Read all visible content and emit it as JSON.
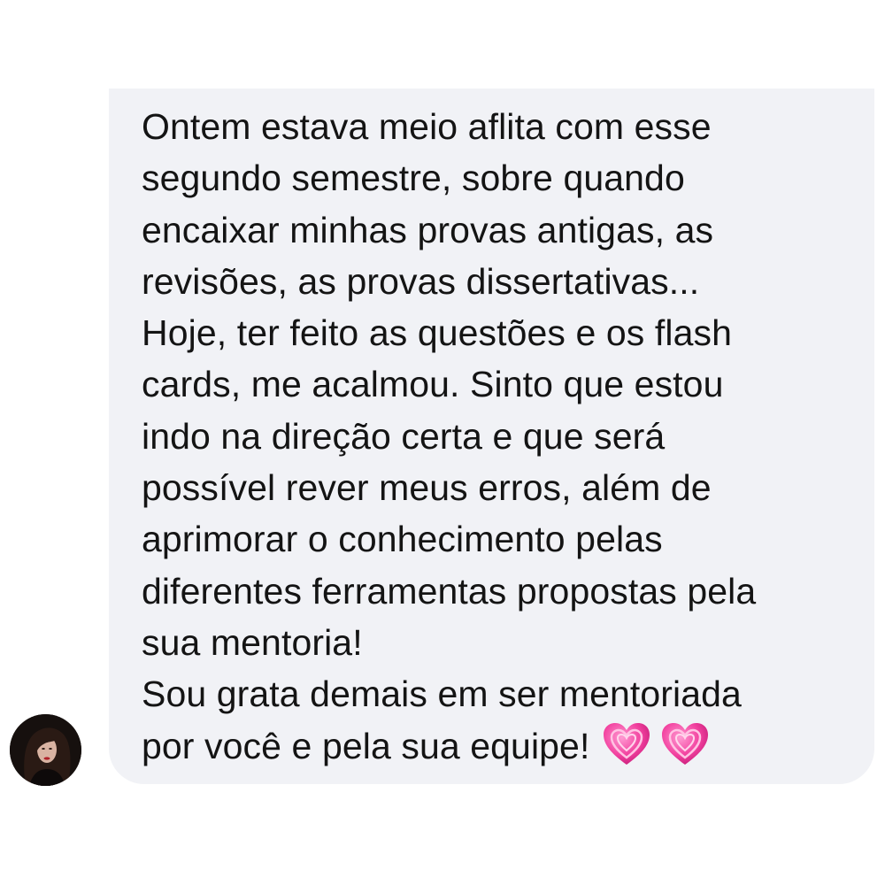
{
  "message": {
    "lines": [
      "Ontem estava meio aflita com esse",
      "segundo semestre, sobre quando",
      "encaixar minhas provas antigas, as",
      "revisões, as provas dissertativas...",
      "Hoje, ter feito as questões e os flash",
      "cards, me acalmou. Sinto que estou",
      "indo na direção certa e que será",
      "possível rever meus erros, além de",
      "aprimorar o conhecimento pelas",
      "diferentes ferramentas propostas pela",
      "sua mentoria!",
      "Sou grata demais em ser mentoriada",
      "por você e pela sua equipe!"
    ],
    "emoji": [
      "sparkling-heart-icon",
      "sparkling-heart-icon"
    ],
    "bubble_color": "#f1f2f6",
    "text_color": "#141414",
    "heart_color": "#ee4aa8"
  },
  "sender": {
    "avatar": "avatar-photo"
  }
}
